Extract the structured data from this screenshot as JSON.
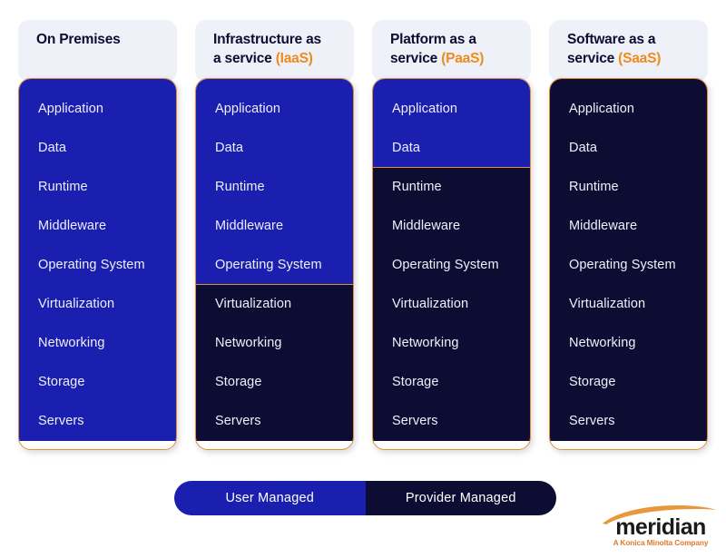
{
  "palette": {
    "user_managed_blue": "#1a1fb0",
    "provider_managed_navy": "#0d0d33",
    "accent_orange": "#e0912f",
    "acronym_orange": "#f08a1c",
    "header_card_bg": "#eef1f7",
    "page_bg": "#ffffff",
    "layer_text": "#eef0fa"
  },
  "columns": [
    {
      "id": "on-premises",
      "title_lines": [
        "On Premises"
      ],
      "acronym": "",
      "layers": [
        {
          "label": "Application",
          "managed_by": "user"
        },
        {
          "label": "Data",
          "managed_by": "user"
        },
        {
          "label": "Runtime",
          "managed_by": "user"
        },
        {
          "label": "Middleware",
          "managed_by": "user"
        },
        {
          "label": "Operating System",
          "managed_by": "user"
        },
        {
          "label": "Virtualization",
          "managed_by": "user"
        },
        {
          "label": "Networking",
          "managed_by": "user"
        },
        {
          "label": "Storage",
          "managed_by": "user"
        },
        {
          "label": "Servers",
          "managed_by": "user"
        }
      ]
    },
    {
      "id": "iaas",
      "title_lines": [
        "Infrastructure as",
        "a service "
      ],
      "acronym": "(IaaS)",
      "layers": [
        {
          "label": "Application",
          "managed_by": "user"
        },
        {
          "label": "Data",
          "managed_by": "user"
        },
        {
          "label": "Runtime",
          "managed_by": "user"
        },
        {
          "label": "Middleware",
          "managed_by": "user"
        },
        {
          "label": "Operating System",
          "managed_by": "user"
        },
        {
          "label": "Virtualization",
          "managed_by": "provider"
        },
        {
          "label": "Networking",
          "managed_by": "provider"
        },
        {
          "label": "Storage",
          "managed_by": "provider"
        },
        {
          "label": "Servers",
          "managed_by": "provider"
        }
      ]
    },
    {
      "id": "paas",
      "title_lines": [
        "Platform as a",
        "service "
      ],
      "acronym": "(PaaS)",
      "layers": [
        {
          "label": "Application",
          "managed_by": "user"
        },
        {
          "label": "Data",
          "managed_by": "user"
        },
        {
          "label": "Runtime",
          "managed_by": "provider"
        },
        {
          "label": "Middleware",
          "managed_by": "provider"
        },
        {
          "label": "Operating System",
          "managed_by": "provider"
        },
        {
          "label": "Virtualization",
          "managed_by": "provider"
        },
        {
          "label": "Networking",
          "managed_by": "provider"
        },
        {
          "label": "Storage",
          "managed_by": "provider"
        },
        {
          "label": "Servers",
          "managed_by": "provider"
        }
      ]
    },
    {
      "id": "saas",
      "title_lines": [
        "Software as a",
        "service "
      ],
      "acronym": "(SaaS)",
      "layers": [
        {
          "label": "Application",
          "managed_by": "provider"
        },
        {
          "label": "Data",
          "managed_by": "provider"
        },
        {
          "label": "Runtime",
          "managed_by": "provider"
        },
        {
          "label": "Middleware",
          "managed_by": "provider"
        },
        {
          "label": "Operating System",
          "managed_by": "provider"
        },
        {
          "label": "Virtualization",
          "managed_by": "provider"
        },
        {
          "label": "Networking",
          "managed_by": "provider"
        },
        {
          "label": "Storage",
          "managed_by": "provider"
        },
        {
          "label": "Servers",
          "managed_by": "provider"
        }
      ]
    }
  ],
  "legend": {
    "user_label": "User Managed",
    "provider_label": "Provider Managed"
  },
  "logo": {
    "wordmark": "meridian",
    "tagline": "A Konica Minolta Company",
    "arc_color": "#e8983a"
  }
}
